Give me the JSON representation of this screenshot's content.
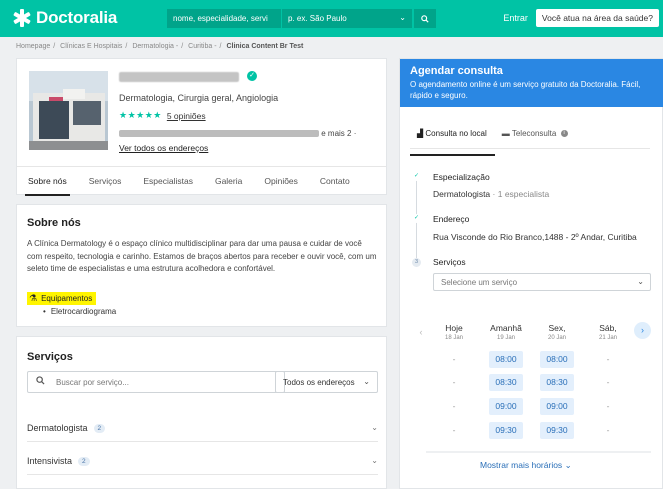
{
  "header": {
    "brand": "Doctoralia",
    "search_specialty": "nome, especialidade, servi",
    "search_city_placeholder": "p. ex. São Paulo",
    "login": "Entrar",
    "pro_button": "Você atua na área da saúde?"
  },
  "breadcrumb": [
    "Homepage",
    "Clínicas E Hospitais",
    "Dermatologia -",
    "Curitiba -",
    "Clinica Content Br Test"
  ],
  "profile": {
    "specialties": "Dermatologia, Cirurgia geral, Angiologia",
    "stars": "★★★★★",
    "opinions": "5 opiniões",
    "address_suffix": "e mais 2 ·",
    "all_addresses": "Ver todos os endereços",
    "tabs": [
      "Sobre nós",
      "Serviços",
      "Especialistas",
      "Galeria",
      "Opiniões",
      "Contato"
    ]
  },
  "about": {
    "title": "Sobre nós",
    "text": "A Clínica Dermatology é o espaço clínico multidisciplinar para dar uma pausa e cuidar de você com respeito, tecnologia e carinho. Estamos de braços abertos para receber e ouvir você, com um seleto time de especialistas e uma estrutura acolhedora e confortável.",
    "equipment_label": "Equipamentos",
    "equipment_items": [
      "Eletrocardiograma"
    ]
  },
  "services": {
    "title": "Serviços",
    "search_placeholder": "Buscar por serviço...",
    "address_filter": "Todos os endereços",
    "rows": [
      {
        "name": "Dermatologista",
        "count": "2"
      },
      {
        "name": "Intensivista",
        "count": "2"
      }
    ]
  },
  "booking": {
    "title": "Agendar consulta",
    "subtitle": "O agendamento online é um serviço gratuito da Doctoralia. Fácil, rápido e seguro.",
    "tab_local": "Consulta no local",
    "tab_tele": "Teleconsulta",
    "step1_title": "Especialização",
    "step1_value": "Dermatologista",
    "step1_extra": "· 1 especialista",
    "step2_title": "Endereço",
    "step2_value": "Rua Visconde do Rio Branco,1488 - 2º Andar, Curitiba",
    "step3_number": "3",
    "step3_title": "Serviços",
    "service_placeholder": "Selecione um serviço",
    "days": [
      {
        "name": "Hoje",
        "date": "18 Jan"
      },
      {
        "name": "Amanhã",
        "date": "19 Jan"
      },
      {
        "name": "Sex,",
        "date": "20 Jan"
      },
      {
        "name": "Sáb,",
        "date": "21 Jan"
      }
    ],
    "slots": [
      [
        "-",
        "08:00",
        "08:00",
        "-"
      ],
      [
        "-",
        "08:30",
        "08:30",
        "-"
      ],
      [
        "-",
        "09:00",
        "09:00",
        "-"
      ],
      [
        "-",
        "09:30",
        "09:30",
        "-"
      ]
    ],
    "more_hours": "Mostrar mais horários"
  }
}
